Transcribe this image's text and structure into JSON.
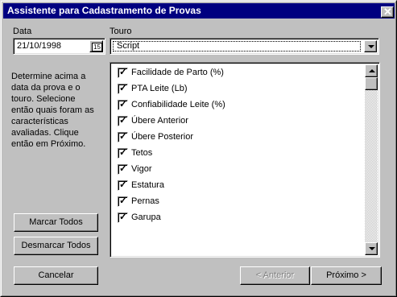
{
  "window": {
    "title": "Assistente para Cadastramento de Provas"
  },
  "date": {
    "label": "Data",
    "value": "21/10/1998",
    "calendar_glyph": "15"
  },
  "bull": {
    "label": "Touro",
    "selected": "Script"
  },
  "description": "Determine acima a data da prova e o touro. Selecione então quais foram as características avaliadas. Clique então em Próximo.",
  "traits": [
    {
      "label": "Facilidade de Parto (%)",
      "checked": true
    },
    {
      "label": "PTA Leite (Lb)",
      "checked": true
    },
    {
      "label": "Confiabilidade Leite (%)",
      "checked": true
    },
    {
      "label": "Úbere Anterior",
      "checked": true
    },
    {
      "label": "Úbere Posterior",
      "checked": true
    },
    {
      "label": "Tetos",
      "checked": true
    },
    {
      "label": "Vigor",
      "checked": true
    },
    {
      "label": "Estatura",
      "checked": true
    },
    {
      "label": "Pernas",
      "checked": true
    },
    {
      "label": "Garupa",
      "checked": true
    }
  ],
  "buttons": {
    "mark_all": "Marcar Todos",
    "unmark_all": "Desmarcar Todos",
    "cancel": "Cancelar",
    "back": "< Anterior",
    "next": "Próximo >",
    "close": "✕"
  },
  "colors": {
    "titlebar": "#000080",
    "face": "#c0c0c0"
  }
}
